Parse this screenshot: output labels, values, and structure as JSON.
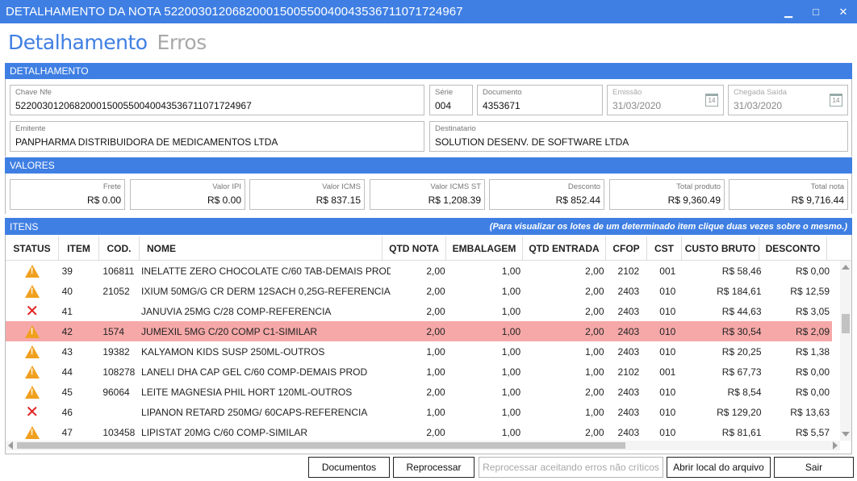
{
  "window": {
    "title": "DETALHAMENTO DA NOTA 52200301206820001500550040043536711071724967",
    "minimize_glyph": "▁",
    "maximize_glyph": "□",
    "close_glyph": "✕"
  },
  "tabs": [
    {
      "label": "Detalhamento",
      "active": true
    },
    {
      "label": "Erros",
      "active": false
    }
  ],
  "detalhamento": {
    "header": "DETALHAMENTO",
    "chave": {
      "label": "Chave Nfe",
      "value": "52200301206820001500550040043536711071724967"
    },
    "serie": {
      "label": "Série",
      "value": "004"
    },
    "documento": {
      "label": "Documento",
      "value": "4353671"
    },
    "emissao": {
      "label": "Emissão",
      "value": "31/03/2020"
    },
    "chegada": {
      "label": "Chegada Saída",
      "value": "31/03/2020"
    },
    "calendar_glyph": "14",
    "emitente": {
      "label": "Emitente",
      "value": "PANPHARMA DISTRIBUIDORA DE MEDICAMENTOS LTDA"
    },
    "destinatario": {
      "label": "Destinatario",
      "value": "SOLUTION DESENV. DE SOFTWARE LTDA"
    }
  },
  "valores": {
    "header": "VALORES",
    "frete": {
      "label": "Frete",
      "value": "R$ 0.00"
    },
    "ipi": {
      "label": "Valor IPI",
      "value": "R$ 0.00"
    },
    "icms": {
      "label": "Valor ICMS",
      "value": "R$ 837.15"
    },
    "icms_st": {
      "label": "Valor ICMS ST",
      "value": "R$ 1,208.39"
    },
    "desconto": {
      "label": "Desconto",
      "value": "R$ 852.44"
    },
    "total_produto": {
      "label": "Total produto",
      "value": "R$ 9,360.49"
    },
    "total_nota": {
      "label": "Total nota",
      "value": "R$ 9,716.44"
    }
  },
  "itens": {
    "header": "ITENS",
    "hint": "(Para visualizar os lotes de um determinado item clique duas vezes sobre o mesmo.)",
    "columns": {
      "status": "STATUS",
      "item": "ITEM",
      "cod": "COD.",
      "nome": "NOME",
      "qtd_nota": "QTD NOTA",
      "embalagem": "EMBALAGEM",
      "qtd_entrada": "QTD ENTRADA",
      "cfop": "CFOP",
      "cst": "CST",
      "custo_bruto": "CUSTO BRUTO",
      "desconto": "DESCONTO"
    },
    "rows": [
      {
        "status": "warning",
        "item": "39",
        "cod": "106811",
        "nome": "INELATTE ZERO CHOCOLATE C/60 TAB-DEMAIS PROD",
        "qtd_nota": "2,00",
        "embalagem": "1,00",
        "qtd_entrada": "2,00",
        "cfop": "2102",
        "cst": "001",
        "custo_bruto": "R$ 58,46",
        "desconto": "R$ 0,00"
      },
      {
        "status": "warning",
        "item": "40",
        "cod": "21052",
        "nome": "IXIUM 50MG/G CR DERM 12SACH 0,25G-REFERENCIA",
        "qtd_nota": "2,00",
        "embalagem": "1,00",
        "qtd_entrada": "2,00",
        "cfop": "2403",
        "cst": "010",
        "custo_bruto": "R$ 184,61",
        "desconto": "R$ 12,59"
      },
      {
        "status": "error",
        "item": "41",
        "cod": "",
        "nome": "JANUVIA 25MG C/28 COMP-REFERENCIA",
        "qtd_nota": "2,00",
        "embalagem": "1,00",
        "qtd_entrada": "2,00",
        "cfop": "2403",
        "cst": "010",
        "custo_bruto": "R$ 44,63",
        "desconto": "R$ 3,05"
      },
      {
        "status": "warning",
        "item": "42",
        "cod": "1574",
        "nome": "JUMEXIL 5MG C/20 COMP C1-SIMILAR",
        "qtd_nota": "2,00",
        "embalagem": "1,00",
        "qtd_entrada": "2,00",
        "cfop": "2403",
        "cst": "010",
        "custo_bruto": "R$ 30,54",
        "desconto": "R$ 2,09",
        "selected": true
      },
      {
        "status": "warning",
        "item": "43",
        "cod": "19382",
        "nome": "KALYAMON KIDS SUSP 250ML-OUTROS",
        "qtd_nota": "1,00",
        "embalagem": "1,00",
        "qtd_entrada": "1,00",
        "cfop": "2403",
        "cst": "010",
        "custo_bruto": "R$ 20,25",
        "desconto": "R$ 1,38"
      },
      {
        "status": "warning",
        "item": "44",
        "cod": "108278",
        "nome": "LANELI DHA CAP GEL C/60 COMP-DEMAIS PROD",
        "qtd_nota": "1,00",
        "embalagem": "1,00",
        "qtd_entrada": "1,00",
        "cfop": "2102",
        "cst": "001",
        "custo_bruto": "R$ 67,73",
        "desconto": "R$ 0,00"
      },
      {
        "status": "warning",
        "item": "45",
        "cod": "96064",
        "nome": "LEITE MAGNESIA PHIL HORT 120ML-OUTROS",
        "qtd_nota": "2,00",
        "embalagem": "1,00",
        "qtd_entrada": "2,00",
        "cfop": "2403",
        "cst": "010",
        "custo_bruto": "R$ 8,54",
        "desconto": "R$ 0,00"
      },
      {
        "status": "error",
        "item": "46",
        "cod": "",
        "nome": "LIPANON RETARD 250MG/ 60CAPS-REFERENCIA",
        "qtd_nota": "1,00",
        "embalagem": "1,00",
        "qtd_entrada": "1,00",
        "cfop": "2403",
        "cst": "010",
        "custo_bruto": "R$ 129,20",
        "desconto": "R$ 13,63"
      },
      {
        "status": "warning",
        "item": "47",
        "cod": "103458",
        "nome": "LIPISTAT 20MG C/60 COMP-SIMILAR",
        "qtd_nota": "2,00",
        "embalagem": "1,00",
        "qtd_entrada": "2,00",
        "cfop": "2403",
        "cst": "010",
        "custo_bruto": "R$ 81,61",
        "desconto": "R$ 5,57"
      }
    ]
  },
  "buttons": {
    "documentos": "Documentos",
    "reprocessar": "Reprocessar",
    "reprocessar_aceitando": "Reprocessar aceitando erros não críticos",
    "abrir_local": "Abrir local do arquivo",
    "sair": "Sair"
  },
  "colors": {
    "accent": "#3f7fe3",
    "selected_row": "#f6a8a8",
    "warning": "#f0a01e",
    "error": "#e02020"
  }
}
